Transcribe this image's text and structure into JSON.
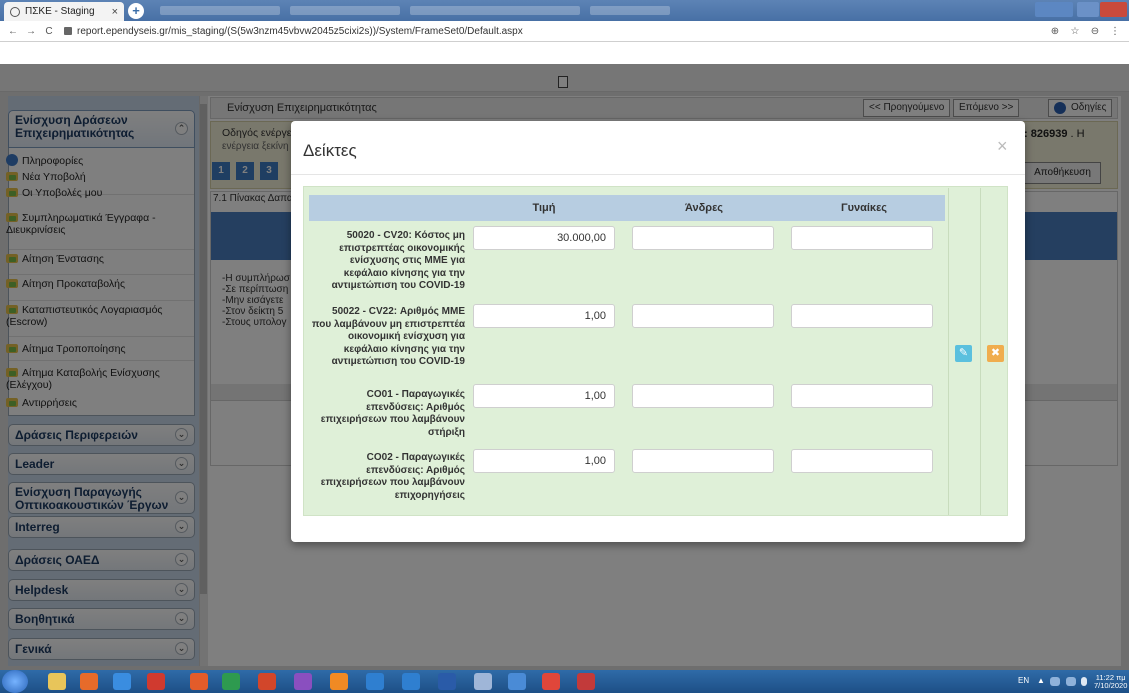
{
  "browser": {
    "tab_title": "ΠΣΚΕ - Staging",
    "tab_close": "×",
    "new_tab": "+",
    "url": "report.ependyseis.gr/mis_staging/(S(5w3nzm45vbvw2045z5cixi2s))/System/FrameSet0/Default.aspx",
    "back": "←",
    "forward": "→",
    "reload": "C",
    "zoom_icon": "⊕",
    "star_icon": "☆",
    "account_icon": "⊖",
    "menu_icon": "⋮"
  },
  "sidebar": {
    "sections": [
      {
        "label_line1": "Ενίσχυση Δράσεων",
        "label_line2": "Επιχειρηματικότητας",
        "chevron": "⌃"
      },
      {
        "label": "Δράσεις Περιφερειών",
        "chevron": "⌄"
      },
      {
        "label": "Leader",
        "chevron": "⌄"
      },
      {
        "label_line1": "Ενίσχυση Παραγωγής",
        "label_line2": "Οπτικοακουστικών Έργων",
        "chevron": "⌄"
      },
      {
        "label": "Interreg",
        "chevron": "⌄"
      },
      {
        "label": "Δράσεις ΟΑΕΔ",
        "chevron": "⌄"
      },
      {
        "label": "Helpdesk",
        "chevron": "⌄"
      },
      {
        "label": "Βοηθητικά",
        "chevron": "⌄"
      },
      {
        "label": "Γενικά",
        "chevron": "⌄"
      }
    ],
    "items": [
      {
        "label": "Πληροφορίες"
      },
      {
        "label": "Νέα Υποβολή"
      },
      {
        "label": "Οι Υποβολές μου"
      },
      {
        "label_line1": "Συμπληρωματικά Έγγραφα -",
        "label_line2": "Διευκρινίσεις"
      },
      {
        "label": "Αίτηση Ένστασης"
      },
      {
        "label": "Αίτηση Προκαταβολής"
      },
      {
        "label_line1": "Καταπιστευτικός Λογαριασμός",
        "label_line2": "(Escrow)"
      },
      {
        "label": "Αίτημα Τροποποίησης"
      },
      {
        "label_line1": "Αίτημα Καταβολής Ενίσχυσης",
        "label_line2": "(Ελέγχου)"
      },
      {
        "label": "Αντιρρήσεις"
      }
    ]
  },
  "background": {
    "header_title": "Ενίσχυση Επιχειρηματικότητας",
    "prev_button": "<< Προηγούμενο",
    "next_button": "Επόμενο >>",
    "help_button": "Οδηγίες",
    "wizard_line1": "Οδηγός ενέργε",
    "wizard_line2": "ενέργεια ξεκίνη",
    "steps": [
      "1",
      "2",
      "3"
    ],
    "code_prefix": ":",
    "code_number": "826939",
    "code_suffix": ". Η",
    "save_button": "Αποθήκευση",
    "panel_title": "7.1 Πίνακας Δαπαν",
    "notes": [
      "-Η συμπλήρωσ",
      "-Σε περίπτωση",
      "-Μην εισάγετε",
      "-Στον δείκτη 5",
      "-Στους υπολογ"
    ]
  },
  "modal": {
    "title": "Δείκτες",
    "close": "×",
    "columns": {
      "value": "Τιμή",
      "men": "Άνδρες",
      "women": "Γυναίκες"
    },
    "rows": [
      {
        "label_lines": [
          "50020 - CV20: Κόστος μη",
          "επιστρεπτέας οικονομικής",
          "ενίσχυσης στις ΜΜΕ για",
          "κεφάλαιο κίνησης για την",
          "αντιμετώπιση του COVID-19"
        ],
        "value": "30.000,00",
        "men": "",
        "women": ""
      },
      {
        "label_lines": [
          "50022 - CV22: Αριθμός ΜΜΕ",
          "που λαμβάνουν μη επιστρεπτέα",
          "οικονομική ενίσχυση για",
          "κεφάλαιο κίνησης για την",
          "αντιμετώπιση του COVID-19"
        ],
        "value": "1,00",
        "men": "",
        "women": ""
      },
      {
        "label_lines": [
          "CO01 - Παραγωγικές",
          "επενδύσεις: Αριθμός",
          "επιχειρήσεων που λαμβάνουν",
          "στήριξη"
        ],
        "value": "1,00",
        "men": "",
        "women": ""
      },
      {
        "label_lines": [
          "CO02 - Παραγωγικές",
          "επενδύσεις: Αριθμός",
          "επιχειρήσεων που λαμβάνουν",
          "επιχορηγήσεις"
        ],
        "value": "1,00",
        "men": "",
        "women": ""
      }
    ],
    "edit_icon": "✎",
    "delete_icon": "✖",
    "colors": {
      "header_bg": "#b7cde1",
      "panel_bg": "#dff0d8",
      "edit": "#5bc0de",
      "delete": "#f0ad4e"
    }
  },
  "taskbar": {
    "lang": "EN",
    "tray_arrow": "▲",
    "time": "11:22 πμ",
    "date": "7/10/2020"
  }
}
